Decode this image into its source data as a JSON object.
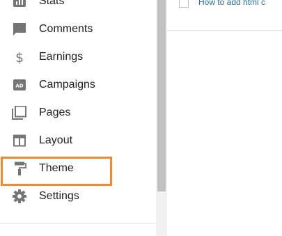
{
  "sidebar": {
    "items": [
      {
        "label": "Stats",
        "icon": "stats-icon"
      },
      {
        "label": "Comments",
        "icon": "comments-icon"
      },
      {
        "label": "Earnings",
        "icon": "dollar-icon"
      },
      {
        "label": "Campaigns",
        "icon": "ad-icon"
      },
      {
        "label": "Pages",
        "icon": "pages-icon"
      },
      {
        "label": "Layout",
        "icon": "layout-icon"
      },
      {
        "label": "Theme",
        "icon": "paint-roller-icon",
        "highlighted": true
      },
      {
        "label": "Settings",
        "icon": "gear-icon"
      }
    ]
  },
  "main": {
    "posts": [
      {
        "title": "How to add html c"
      }
    ]
  },
  "colors": {
    "highlight": "#f0892f",
    "icon": "#757575",
    "link": "#2a6f97",
    "text": "#212121"
  }
}
